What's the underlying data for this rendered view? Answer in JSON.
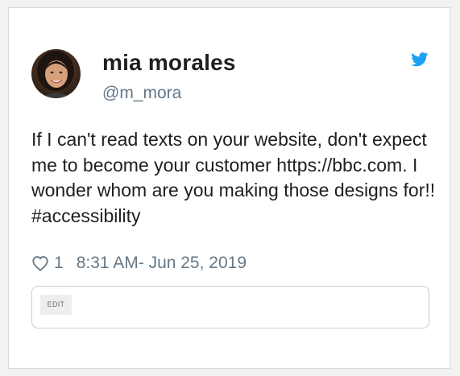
{
  "tweet": {
    "author_name": "mia morales",
    "author_handle": "@m_mora",
    "text": "If I can't read texts on your website, don't expect me to become your customer https://bbc.com. I wonder whom are you making those designs for!! #accessibility",
    "like_count": "1",
    "timestamp": "8:31 AM- Jun 25, 2019"
  },
  "edit": {
    "label": "EDIT"
  },
  "icons": {
    "brand": "twitter-bird-icon",
    "like": "heart-icon"
  },
  "colors": {
    "twitter_blue": "#1da1f2",
    "muted_text": "#657786",
    "main_text": "#1f1f1f"
  }
}
